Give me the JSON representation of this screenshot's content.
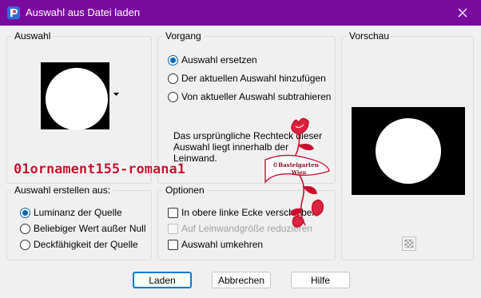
{
  "window": {
    "title": "Auswahl aus Datei laden"
  },
  "groups": {
    "auswahl": "Auswahl",
    "vorgang": "Vorgang",
    "vorschau": "Vorschau",
    "erstellen": "Auswahl erstellen aus:",
    "optionen": "Optionen"
  },
  "vorgang_options": [
    {
      "label": "Auswahl ersetzen",
      "checked": true
    },
    {
      "label": "Der aktuellen Auswahl hinzufügen",
      "checked": false
    },
    {
      "label": "Von aktueller Auswahl subtrahieren",
      "checked": false
    }
  ],
  "info_text": {
    "line1": "Das ursprüngliche Rechteck dieser",
    "line2": "Auswahl liegt innerhalb der",
    "line3": "Leinwand."
  },
  "erstellen_options": [
    {
      "label": "Luminanz der Quelle",
      "checked": true
    },
    {
      "label": "Beliebiger Wert außer Null",
      "checked": false
    },
    {
      "label": "Deckfähigkeit der Quelle",
      "checked": false
    }
  ],
  "optionen_checks": [
    {
      "label": "In obere linke Ecke verschieben",
      "checked": false,
      "disabled": false
    },
    {
      "label": "Auf Leinwandgröße reduzieren",
      "checked": false,
      "disabled": true
    },
    {
      "label": "Auswahl umkehren",
      "checked": false,
      "disabled": false
    }
  ],
  "buttons": {
    "load": "Laden",
    "cancel": "Abbrechen",
    "help": "Hilfe"
  },
  "overlay": {
    "watermark_name": "01ornament155-romana1",
    "stamp_line1": "©Bastelgarten",
    "stamp_line2": "Wien"
  },
  "colors": {
    "titlebar": "#7a0a9e",
    "accent": "#0063b1",
    "watermark": "#c8102e"
  },
  "icons": {
    "app": "paint-shop-pro-icon",
    "close": "close-icon",
    "dropdown": "dropdown-arrow-icon",
    "checker": "transparency-checker-icon"
  }
}
